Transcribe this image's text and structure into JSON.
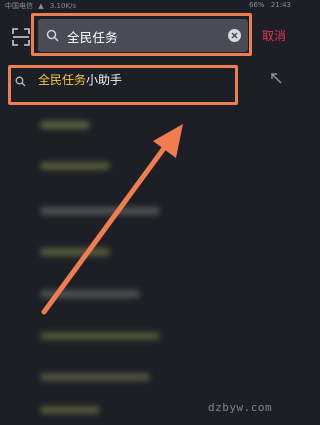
{
  "status_bar": {
    "carrier": "中国电信",
    "speed": "3.10K/s",
    "battery": "66%",
    "time": "21:43"
  },
  "search": {
    "query": "全民任务",
    "cancel_label": "取消"
  },
  "suggestion": {
    "highlight": "全民任务",
    "rest": "小助手"
  },
  "watermark": "dzbyw.com",
  "colors": {
    "annotation": "#f07d4f",
    "cancel": "#e8305a",
    "highlight": "#f5c642",
    "background": "#1d1f26"
  },
  "icons": [
    "scan-icon",
    "search-icon",
    "clear-icon",
    "suggestion-search-icon",
    "fill-arrow-icon"
  ]
}
